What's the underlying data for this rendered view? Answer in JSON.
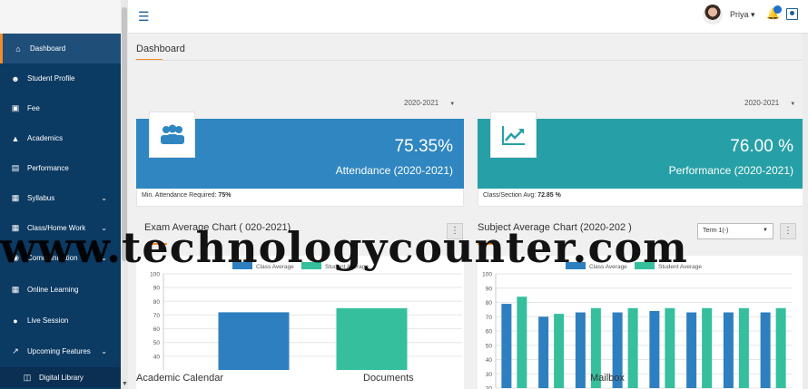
{
  "topbar": {
    "user_name": "Priya ▾"
  },
  "sidebar": {
    "items": [
      {
        "label": "Dashboard",
        "icon": "home-icon"
      },
      {
        "label": "Student Profile",
        "icon": "user-icon"
      },
      {
        "label": "Fee",
        "icon": "money-icon"
      },
      {
        "label": "Academics",
        "icon": "graduation-cap-icon"
      },
      {
        "label": "Performance",
        "icon": "bar-chart-icon"
      },
      {
        "label": "Syllabus",
        "icon": "book-icon"
      },
      {
        "label": "Class/Home Work",
        "icon": "book-icon"
      },
      {
        "label": "Communication",
        "icon": "chat-icon"
      },
      {
        "label": "Online Learning",
        "icon": "book-icon"
      },
      {
        "label": "Live Session",
        "icon": "circle-play-icon"
      },
      {
        "label": "Upcoming Features",
        "icon": "external-link-icon"
      },
      {
        "label": "Digital Library",
        "icon": "document-icon"
      }
    ]
  },
  "main": {
    "title": "Dashboard",
    "year_left": "2020-2021",
    "year_right": "2020-2021",
    "attendance": {
      "value": "75.35%",
      "label": "Attendance (2020-2021)",
      "foot_prefix": "Min. Attendance Required: ",
      "foot_value": "75%",
      "color": "#2f86c0"
    },
    "performance": {
      "value": "76.00 %",
      "label": "Performance (2020-2021)",
      "foot_prefix": "Class/Section Avg: ",
      "foot_value": "72.85 %",
      "color": "#26a0a6"
    },
    "exam_chart_title": "Exam Average Chart ( 020-2021)",
    "subject_chart_title": "Subject Average Chart (2020-202 )",
    "term_select": "Term 1(-)",
    "bottom_labels": [
      "Academic Calendar",
      "Documents",
      "Mailbox"
    ]
  },
  "watermark": "www.technologycounter.com",
  "colors": {
    "class_avg": "#2e7fbf",
    "student_avg": "#36bf9c",
    "accent": "#f28c28",
    "sidebar": "#0b3a63"
  },
  "chart_data": [
    {
      "type": "bar",
      "title": "",
      "categories": [
        ""
      ],
      "series": [
        {
          "name": "Class Average",
          "values": [
            72
          ]
        },
        {
          "name": "Student Average",
          "values": [
            75
          ]
        }
      ],
      "ylim": [
        30,
        100
      ],
      "yticks": [
        40,
        50,
        60,
        70,
        80,
        90,
        100
      ],
      "grid": true,
      "legend": "top"
    },
    {
      "type": "bar",
      "title": "",
      "categories": [
        "",
        "",
        "",
        "",
        "",
        "",
        "",
        ""
      ],
      "series": [
        {
          "name": "Class Average",
          "values": [
            79,
            70,
            73,
            73,
            74,
            73,
            73,
            73
          ]
        },
        {
          "name": "Student Average",
          "values": [
            84,
            72,
            76,
            76,
            76,
            76,
            76,
            76
          ]
        }
      ],
      "ylim": [
        20,
        100
      ],
      "yticks": [
        20,
        30,
        40,
        50,
        60,
        70,
        80,
        90,
        100
      ],
      "grid": true,
      "legend": "top"
    }
  ]
}
